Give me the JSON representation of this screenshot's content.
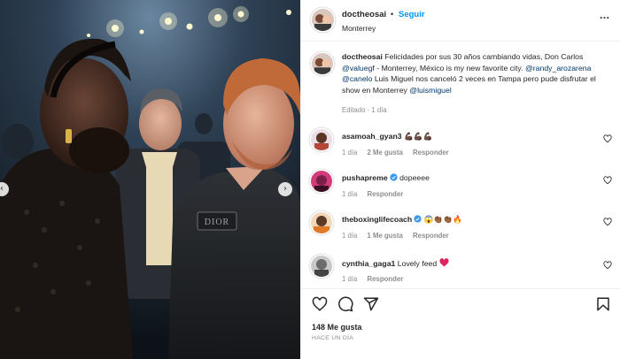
{
  "post": {
    "username": "doctheosai",
    "follow_label": "Seguir",
    "dot": "•",
    "location": "Monterrey",
    "more": "...",
    "caption": {
      "username": "doctheosai",
      "part1": "Felicidades por sus 30 años cambiando vidas, Don Carlos ",
      "mention1": "@valuegf",
      "part2": " - Monterrey, México is my new favorite city. ",
      "mention2": "@randy_arozarena",
      "mention3": "@canelo",
      "part3": " Luis Miguel nos canceló 2 veces en Tampa pero pude disfrutar el show en Monterrey ",
      "mention4": "@luismiguel",
      "edited_label": "Editado",
      "edited_time": "1 día"
    },
    "comments": [
      {
        "username": "asamoah_gyan3",
        "text": "💪🏿💪🏿💪🏿",
        "time": "1 día",
        "likes": "2 Me gusta",
        "reply": "Responder",
        "avatar_color": "#b5473a"
      },
      {
        "username": "pushapreme",
        "verified": true,
        "text": "dopeeee",
        "time": "1 día",
        "likes": "",
        "reply": "Responder",
        "avatar_color": "#d33c7a"
      },
      {
        "username": "theboxinglifecoach",
        "verified": true,
        "text": "😱👏🏾👏🏾🔥",
        "time": "1 día",
        "likes": "1 Me gusta",
        "reply": "Responder",
        "avatar_color": "#e07a2a"
      },
      {
        "username": "cynthia_gaga1",
        "text": "Lovely feed",
        "time": "1 día",
        "likes": "",
        "reply": "Responder",
        "avatar_color": "#6c6c6c"
      }
    ],
    "like_count": "148 Me gusta",
    "posted_ago": "HACE UN DÍA",
    "icons": {
      "like": "heart-icon",
      "comment": "comment-icon",
      "share": "share-icon",
      "save": "bookmark-icon",
      "prev": "chevron-left-icon",
      "next": "chevron-right-icon"
    },
    "nav": {
      "prev": "‹",
      "next": "›"
    },
    "colors": {
      "accent": "#0095f6",
      "link": "#00376b",
      "verified": "#3897f0",
      "muted": "#8e8e8e"
    }
  }
}
